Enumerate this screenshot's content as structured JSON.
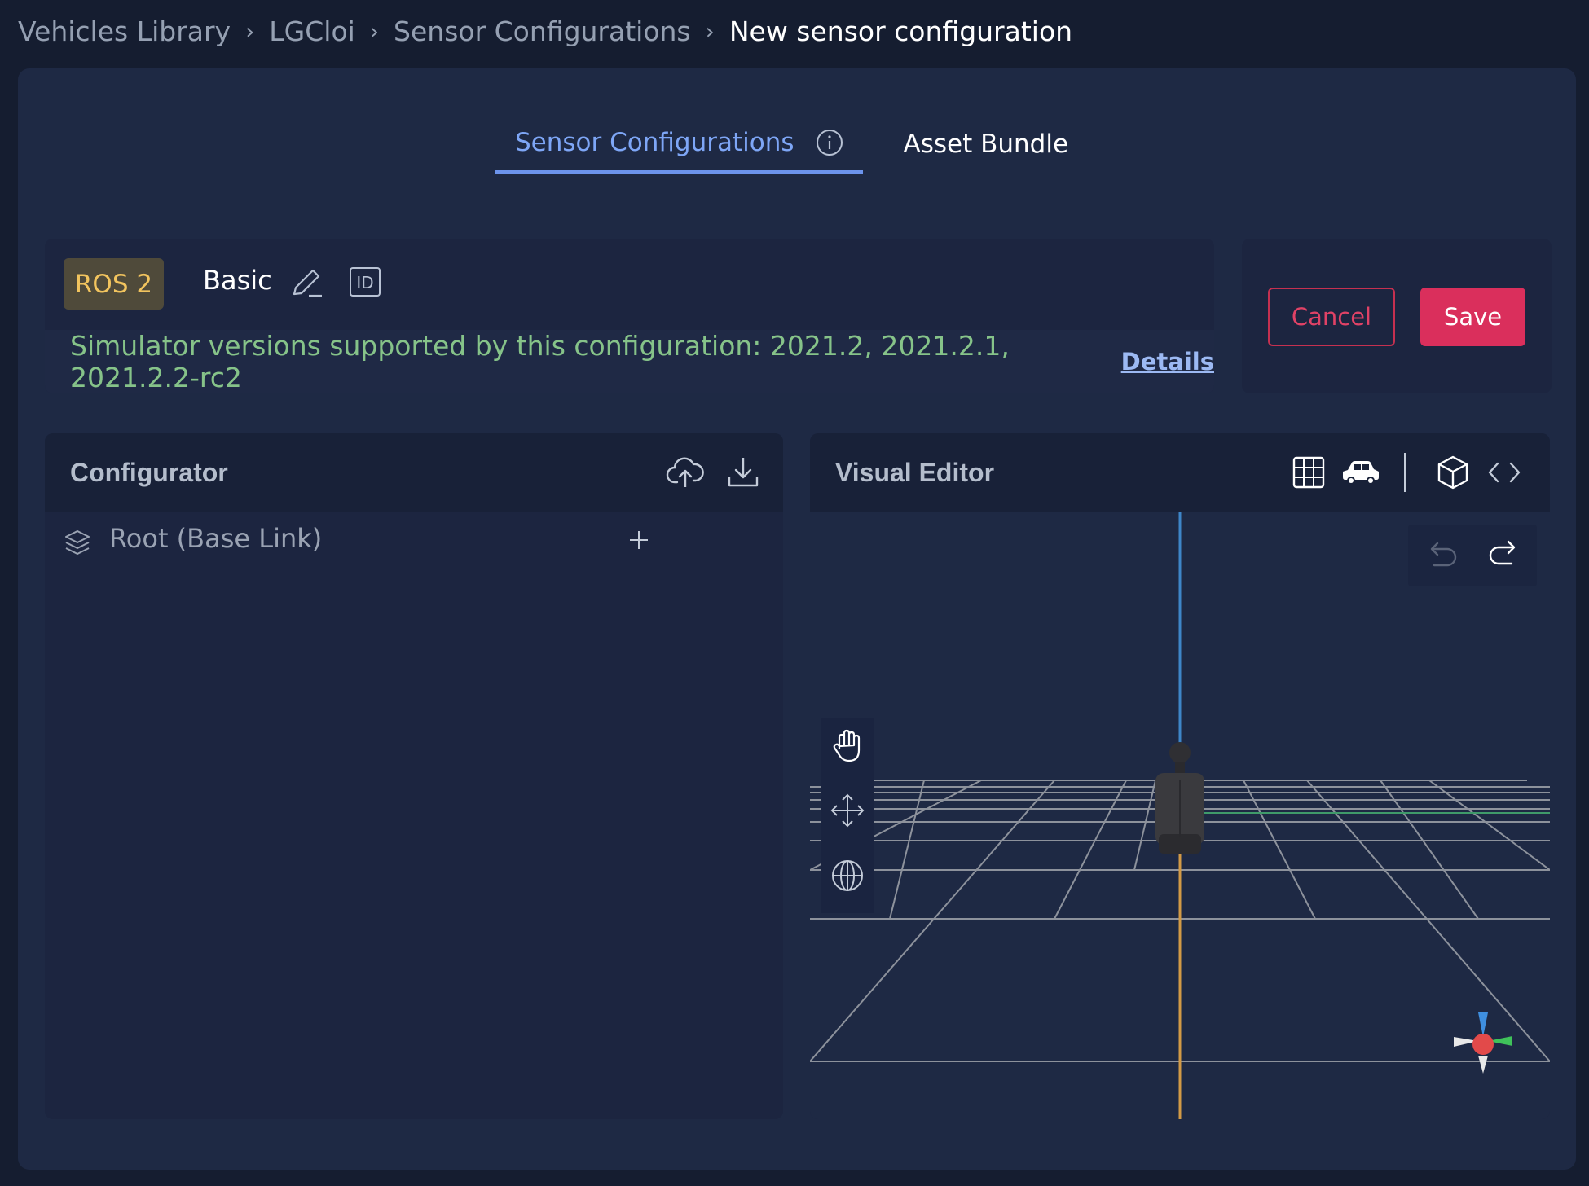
{
  "breadcrumb": {
    "items": [
      "Vehicles Library",
      "LGCloi",
      "Sensor Configurations"
    ],
    "separator": "›",
    "current": "New sensor configuration"
  },
  "tabs": {
    "active": "Sensor Configurations",
    "inactive": "Asset Bundle"
  },
  "config": {
    "badge": "ROS 2",
    "name": "Basic",
    "id_label": "ID",
    "versions_text": "Simulator versions supported by this configuration: 2021.2, 2021.2.1, 2021.2.2-rc2",
    "details_label": "Details"
  },
  "actions": {
    "cancel": "Cancel",
    "save": "Save"
  },
  "configurator": {
    "title": "Configurator",
    "root_label": "Root (Base Link)"
  },
  "visual_editor": {
    "title": "Visual Editor"
  },
  "colors": {
    "accent": "#7ea6f6",
    "save": "#da2f5c",
    "badge_text": "#f2c45e",
    "versions_text": "#86c389"
  }
}
